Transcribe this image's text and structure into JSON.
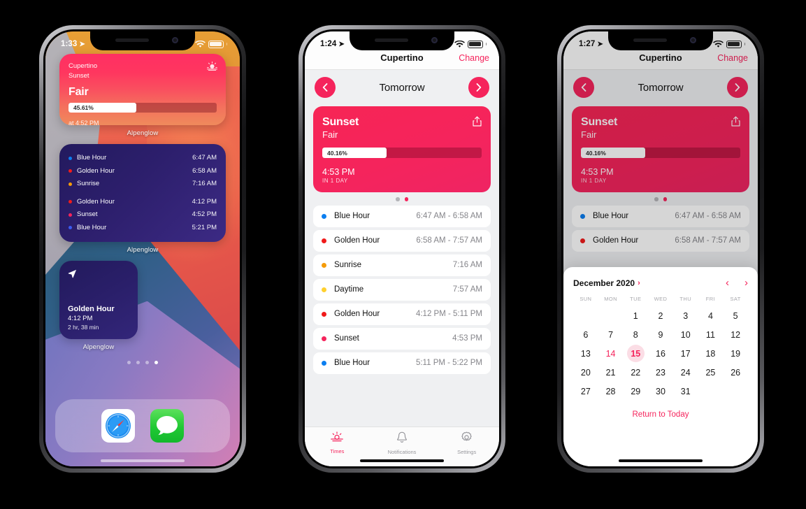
{
  "colors": {
    "accent": "#f5245c",
    "blue_hour": "#0b7ef0",
    "golden_hour": "#f01b1b",
    "sunrise": "#f59b09",
    "daytime": "#ffd02e",
    "sunset": "#f5245c"
  },
  "phone1": {
    "status": {
      "time": "1:33",
      "location_icon": "location-arrow-icon",
      "dots": "....",
      "wifi_icon": "wifi-icon",
      "battery_icon": "battery-icon"
    },
    "widget_sunset": {
      "location": "Cupertino",
      "event": "Sunset",
      "condition": "Fair",
      "progress_label": "45.61%",
      "progress_value": 45.61,
      "footer": "at 4:52 PM",
      "icon": "sunset-icon",
      "label": "Alpenglow"
    },
    "widget_times": {
      "label": "Alpenglow",
      "rows_morning": [
        {
          "name": "Blue Hour",
          "time": "6:47 AM",
          "color": "#0b7ef0"
        },
        {
          "name": "Golden Hour",
          "time": "6:58 AM",
          "color": "#f01b1b"
        },
        {
          "name": "Sunrise",
          "time": "7:16 AM",
          "color": "#f59b09"
        }
      ],
      "rows_evening": [
        {
          "name": "Golden Hour",
          "time": "4:12 PM",
          "color": "#f01b1b"
        },
        {
          "name": "Sunset",
          "time": "4:52 PM",
          "color": "#f5245c"
        },
        {
          "name": "Blue Hour",
          "time": "5:21 PM",
          "color": "#3b5bf0"
        }
      ]
    },
    "widget_gold": {
      "icon": "location-arrow-icon",
      "title": "Golden Hour",
      "time": "4:12 PM",
      "duration": "2 hr, 38 min",
      "label": "Alpenglow"
    },
    "page_dots": {
      "count": 4,
      "active_index": 3
    },
    "dock": [
      {
        "name": "Safari",
        "icon": "safari-icon"
      },
      {
        "name": "Messages",
        "icon": "messages-icon"
      }
    ]
  },
  "phone2": {
    "status": {
      "time": "1:24",
      "location_icon": "location-arrow-icon",
      "dots": "....",
      "wifi_icon": "wifi-icon",
      "battery_icon": "battery-icon"
    },
    "navbar": {
      "title": "Cupertino",
      "change_label": "Change"
    },
    "daybar": {
      "prev_icon": "chevron-left-icon",
      "label": "Tomorrow",
      "next_icon": "chevron-right-icon"
    },
    "hero": {
      "title": "Sunset",
      "subtitle": "Fair",
      "share_icon": "share-icon",
      "progress_label": "40.16%",
      "progress_value": 40.16,
      "time": "4:53 PM",
      "when": "IN 1 DAY"
    },
    "card_dots": {
      "count": 2,
      "active_index": 1
    },
    "rows": [
      {
        "name": "Blue Hour",
        "time": "6:47 AM - 6:58 AM",
        "color": "#0b7ef0"
      },
      {
        "name": "Golden Hour",
        "time": "6:58 AM - 7:57 AM",
        "color": "#f01b1b"
      },
      {
        "name": "Sunrise",
        "time": "7:16 AM",
        "color": "#f59b09"
      },
      {
        "name": "Daytime",
        "time": "7:57 AM",
        "color": "#ffd02e"
      },
      {
        "name": "Golden Hour",
        "time": "4:12 PM - 5:11 PM",
        "color": "#f01b1b"
      },
      {
        "name": "Sunset",
        "time": "4:53 PM",
        "color": "#f5245c"
      },
      {
        "name": "Blue Hour",
        "time": "5:11 PM - 5:22 PM",
        "color": "#0b7ef0"
      }
    ],
    "tabs": [
      {
        "label": "Times",
        "icon": "sunrise-icon",
        "active": true
      },
      {
        "label": "Notifications",
        "icon": "bell-icon",
        "active": false
      },
      {
        "label": "Settings",
        "icon": "gear-icon",
        "active": false
      }
    ]
  },
  "phone3": {
    "status": {
      "time": "1:27",
      "location_icon": "location-arrow-icon",
      "dots": "....",
      "wifi_icon": "wifi-icon",
      "battery_icon": "battery-icon"
    },
    "navbar": {
      "title": "Cupertino",
      "change_label": "Change"
    },
    "daybar": {
      "prev_icon": "chevron-left-icon",
      "label": "Tomorrow",
      "next_icon": "chevron-right-icon"
    },
    "hero": {
      "title": "Sunset",
      "subtitle": "Fair",
      "share_icon": "share-icon",
      "progress_label": "40.16%",
      "progress_value": 40.16,
      "time": "4:53 PM",
      "when": "IN 1 DAY"
    },
    "card_dots": {
      "count": 2,
      "active_index": 1
    },
    "rows": [
      {
        "name": "Blue Hour",
        "time": "6:47 AM - 6:58 AM",
        "color": "#0b7ef0"
      },
      {
        "name": "Golden Hour",
        "time": "6:58 AM - 7:57 AM",
        "color": "#f01b1b"
      }
    ],
    "calendar": {
      "month_label": "December 2020",
      "month_chevron": "chevron-right-icon",
      "prev_icon": "chevron-left-icon",
      "next_icon": "chevron-right-icon",
      "dow": [
        "SUN",
        "MON",
        "TUE",
        "WED",
        "THU",
        "FRI",
        "SAT"
      ],
      "lead_blanks": 2,
      "days": [
        1,
        2,
        3,
        4,
        5,
        6,
        7,
        8,
        9,
        10,
        11,
        12,
        13,
        14,
        15,
        16,
        17,
        18,
        19,
        20,
        21,
        22,
        23,
        24,
        25,
        26,
        27,
        28,
        29,
        30,
        31
      ],
      "today": 14,
      "selected": 15,
      "return_label": "Return to Today"
    }
  }
}
